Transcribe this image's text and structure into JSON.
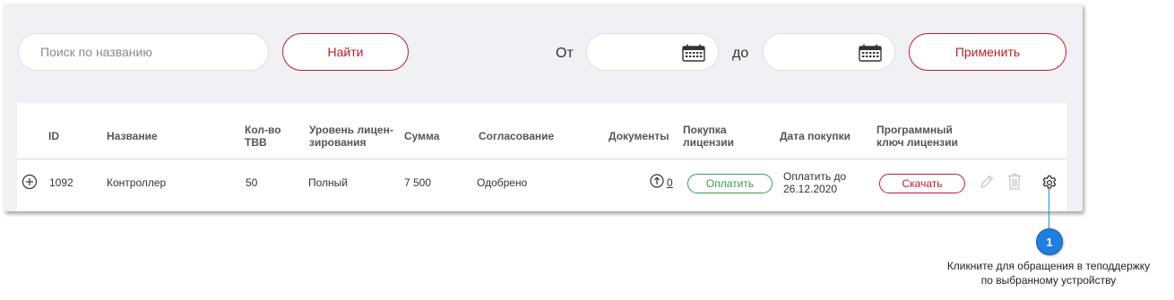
{
  "filters": {
    "search_placeholder": "Поиск по названию",
    "find_label": "Найти",
    "from_label": "От",
    "to_label": "до",
    "apply_label": "Применить",
    "date_icon": "calendar-icon"
  },
  "table": {
    "columns": {
      "id": "ID",
      "name": "Название",
      "count_line1": "Кол-во",
      "count_line2": "ТВВ",
      "level_line1": "Уровень лицен-",
      "level_line2": "зирования",
      "sum": "Сумма",
      "approval": "Согласование",
      "documents": "Документы",
      "purchase_line1": "Покупка",
      "purchase_line2": "лицензии",
      "purchase_date": "Дата покупки",
      "key_line1": "Программный",
      "key_line2": "ключ лицензии"
    },
    "rows": [
      {
        "id": "1092",
        "name": "Контроллер",
        "count": "50",
        "level": "Полный",
        "sum": "7 500",
        "approval": "Одобрено",
        "documents": "0",
        "pay_label": "Оплатить",
        "date_line1": "Оплатить до",
        "date_line2": "26.12.2020",
        "download_label": "Скачать"
      }
    ]
  },
  "callout": {
    "number": "1",
    "text_line1": "Кликните для обращения в теподдержку",
    "text_line2": "по выбранному устройству"
  },
  "colors": {
    "accent": "#b5202e",
    "pay_green": "#3a9a4a",
    "callout_blue": "#1e7fe0",
    "panel_bg": "#f0f0f5"
  }
}
